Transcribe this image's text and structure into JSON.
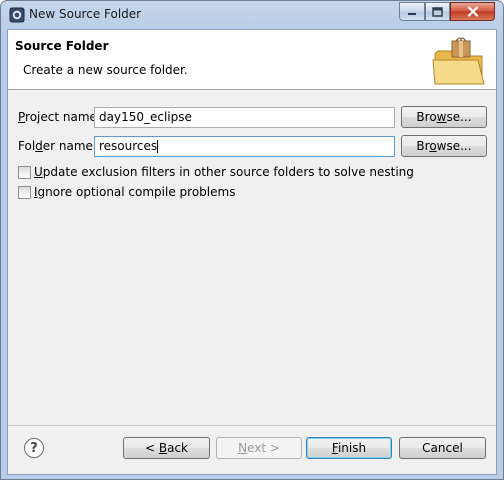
{
  "window": {
    "title": "New Source Folder"
  },
  "header": {
    "title": "Source Folder",
    "description": "Create a new source folder."
  },
  "form": {
    "project_label": "Project name:",
    "project_value": "day150_eclipse",
    "project_browse": "Browse...",
    "folder_label": "Folder name:",
    "folder_value": "resources",
    "folder_browse": "Browse...",
    "checkbox_update_label": "Update exclusion filters in other source folders to solve nesting",
    "checkbox_update_checked": false,
    "checkbox_ignore_label": "Ignore optional compile problems",
    "checkbox_ignore_checked": false
  },
  "footer": {
    "help": "?",
    "back": "< Back",
    "next": "Next >",
    "finish": "Finish",
    "cancel": "Cancel"
  },
  "icons": {
    "app": "eclipse-window-icon",
    "banner": "folder-package-icon",
    "help": "help-icon"
  }
}
